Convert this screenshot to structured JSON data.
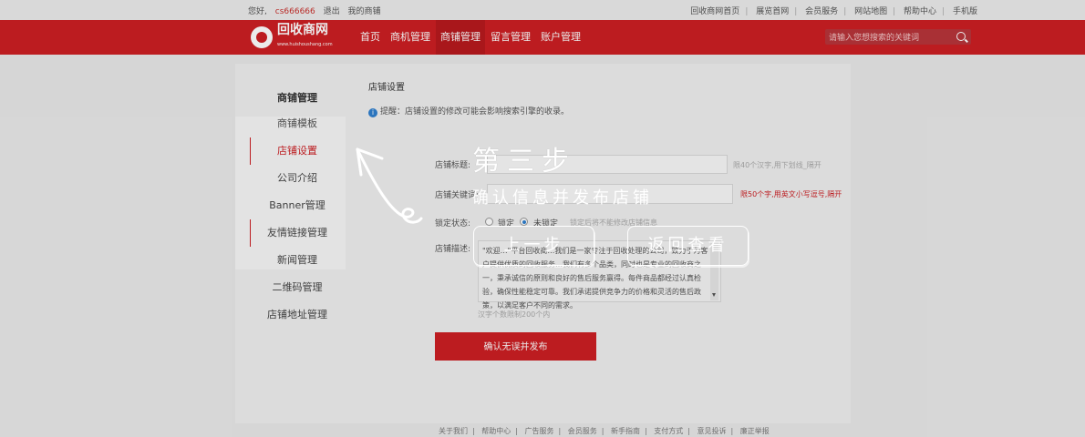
{
  "topbar": {
    "greeting": "您好,",
    "user": "cs666666",
    "logout": "退出",
    "my_shop": "我的商铺",
    "links": [
      "回收商网首页",
      "展览首网",
      "会员服务",
      "网站地图",
      "帮助中心",
      "手机版"
    ]
  },
  "header": {
    "logo_text": "回收商网",
    "logo_url": "www.huishoushang.com",
    "nav": [
      "首页",
      "商机管理",
      "商铺管理",
      "留言管理",
      "账户管理"
    ],
    "active_nav": "商铺管理",
    "search_placeholder": "请输入您想搜索的关键词"
  },
  "sidebar": {
    "title": "商铺管理",
    "items": [
      "商铺模板",
      "店铺设置",
      "公司介绍",
      "Banner管理",
      "友情链接管理",
      "新闻管理",
      "二维码管理",
      "店铺地址管理"
    ],
    "active_index": 1
  },
  "content": {
    "title": "店铺设置",
    "tip": "提醒：店铺设置的修改可能会影响搜索引擎的收录。",
    "fields": {
      "shop_title_label": "店铺标题:",
      "shop_title_hint": "限40个汉字,用下划线_隔开",
      "keywords_label": "店铺关键词:",
      "keywords_hint": "限50个字,用英文小写逗号,隔开",
      "status_label": "锁定状态:",
      "status_locked": "锁定",
      "status_unlocked": "未锁定",
      "status_hint": "锁定后将不能修改店铺信息",
      "desc_label": "店铺描述:",
      "desc_text": "\"欢迎…\"平台回收商…我们是一家专注于回收处理的公司，致力于为客户提供优质的回收服务…我们有多个品类，同时也是专业的回收商之一，秉承诚信的原则和良好的售后服务赢得。每件商品都经过认真检验，确保性能稳定可靠。我们承诺提供竞争力的价格和灵活的售后政策，以满足客户不同的需求。",
      "desc_hint": "汉字个数限制200个内"
    },
    "submit": "确认无误并发布"
  },
  "footer": {
    "links": [
      "关于我们",
      "帮助中心",
      "广告服务",
      "会员服务",
      "新手指南",
      "支付方式",
      "意见投诉",
      "廉正举报"
    ]
  },
  "overlay": {
    "step_title": "第三步",
    "step_desc": "确认信息并发布店铺",
    "back_button": "上一步",
    "review_button": "返回查看"
  },
  "colors": {
    "brand_red": "#cc1f23",
    "info_blue": "#2f7fcf"
  }
}
